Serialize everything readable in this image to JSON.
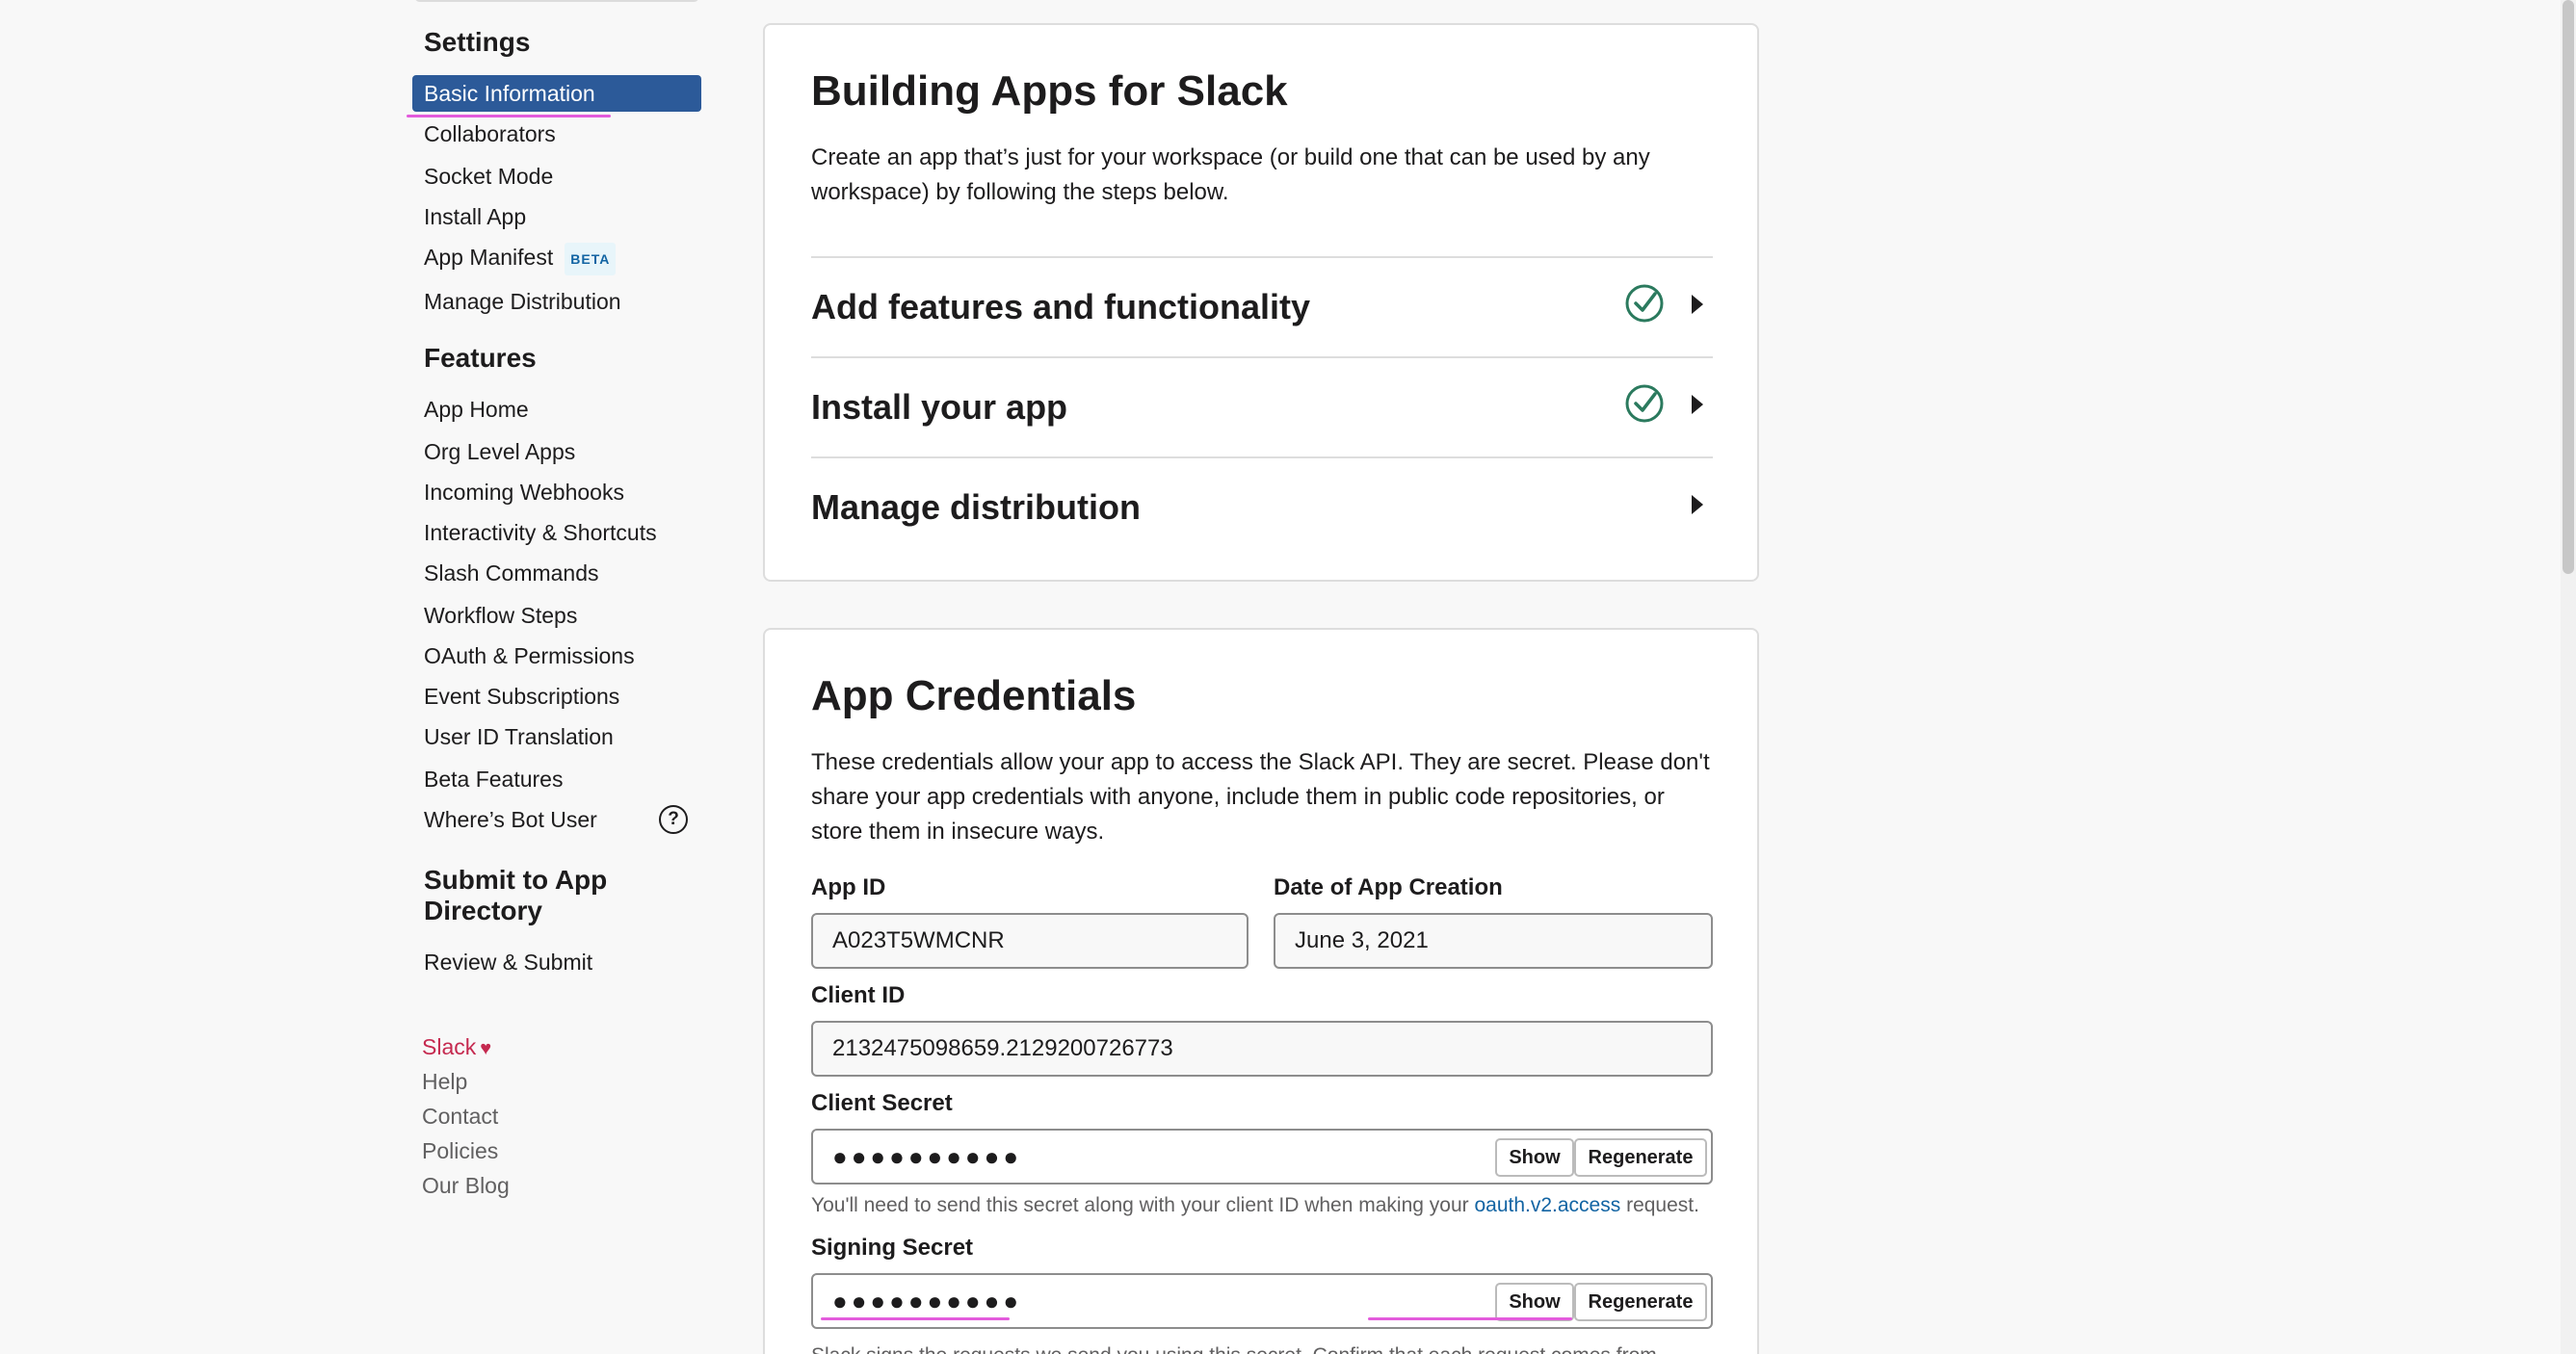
{
  "sidebar": {
    "settings_title": "Settings",
    "settings_items": [
      "Basic Information",
      "Collaborators",
      "Socket Mode",
      "Install App",
      "App Manifest",
      "Manage Distribution"
    ],
    "manifest_badge": "BETA",
    "features_title": "Features",
    "features_items": [
      "App Home",
      "Org Level Apps",
      "Incoming Webhooks",
      "Interactivity & Shortcuts",
      "Slash Commands",
      "Workflow Steps",
      "OAuth & Permissions",
      "Event Subscriptions",
      "User ID Translation",
      "Beta Features",
      "Where’s Bot User"
    ],
    "help_glyph": "?",
    "submit_title": "Submit to App Directory",
    "submit_items": [
      "Review & Submit"
    ],
    "footer": [
      "Slack",
      "Help",
      "Contact",
      "Policies",
      "Our Blog"
    ],
    "heart_glyph": "♥"
  },
  "building": {
    "title": "Building Apps for Slack",
    "description": "Create an app that’s just for your workspace (or build one that can be used by any workspace) by following the steps below.",
    "steps": [
      {
        "label": "Add features and functionality",
        "completed": true
      },
      {
        "label": "Install your app",
        "completed": true
      },
      {
        "label": "Manage distribution",
        "completed": false
      }
    ]
  },
  "credentials": {
    "title": "App Credentials",
    "description": "These credentials allow your app to access the Slack API. They are secret. Please don't share your app credentials with anyone, include them in public code repositories, or store them in insecure ways.",
    "app_id_label": "App ID",
    "app_id": "A023T5WMCNR",
    "date_label": "Date of App Creation",
    "date": "June 3, 2021",
    "client_id_label": "Client ID",
    "client_id": "2132475098659.2129200726773",
    "client_secret_label": "Client Secret",
    "client_secret_masked": "●●●●●●●●●●",
    "show_label": "Show",
    "regenerate_label": "Regenerate",
    "client_secret_hint_pre": "You'll need to send this secret along with your client ID when making your",
    "client_secret_hint_link": "oauth.v2.access",
    "client_secret_hint_post": "request.",
    "signing_secret_label": "Signing Secret",
    "signing_secret_masked": "●●●●●●●●●●",
    "signing_hint": "Slack signs the requests we send you using this secret. Confirm that each request comes from"
  },
  "colors": {
    "active_nav": "#2c5a99",
    "check": "#2b7a5e",
    "link": "#1264a3",
    "brand": "#c5294f",
    "highlight": "#e35bdc"
  }
}
